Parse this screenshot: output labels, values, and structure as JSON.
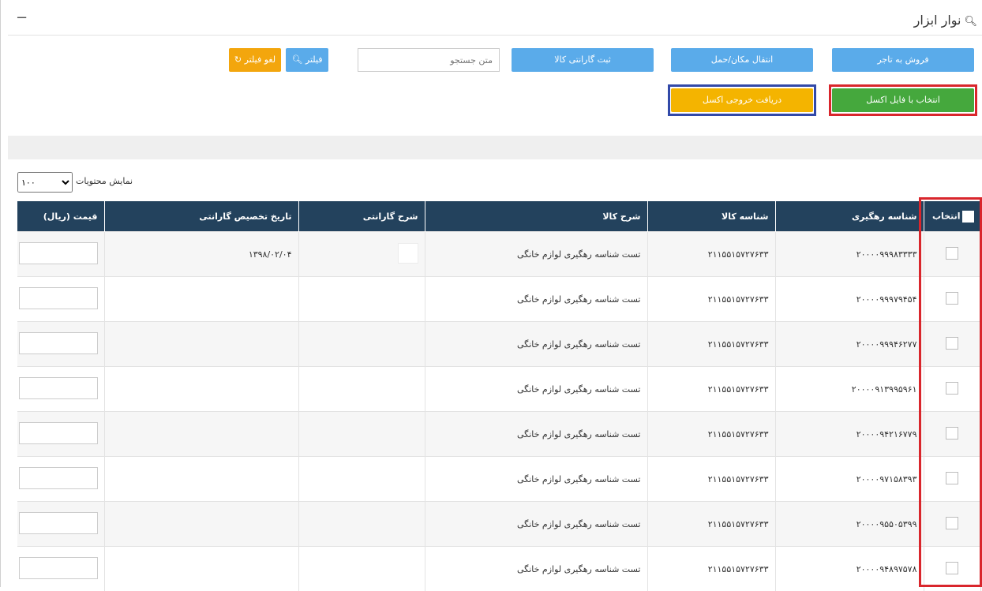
{
  "panel": {
    "title": "نوار ابزار",
    "collapse_symbol": "−"
  },
  "toolbar": {
    "sell_label": "فروش به تاجر",
    "transfer_label": "انتقال مکان/حمل",
    "warranty_label": "ثبت گارانتی کالا",
    "search_placeholder": "متن جستجو",
    "filter_label": "فیلتر",
    "clear_filter_label": "لغو فیلتر",
    "excel_select_label": "انتخاب با فایل اکسل",
    "excel_export_label": "دریافت خروجی اکسل"
  },
  "length": {
    "label": "نمایش محتویات",
    "selected": "۱۰۰"
  },
  "table": {
    "headers": {
      "select": "انتخاب",
      "tracking": "شناسه رهگیری",
      "product_id": "شناسه کالا",
      "product_desc": "شرح کالا",
      "warranty_desc": "شرح گارانتی",
      "warranty_date": "تاریخ تخصیص گارانتی",
      "price": "قیمت (ریال)"
    },
    "rows": [
      {
        "tracking": "۲۰۰۰۰۹۹۹۸۳۳۳۳",
        "product_id": "۲۱۱۵۵۱۵۷۲۷۶۳۳",
        "product_desc": "تست شناسه رهگیری لوازم خانگی",
        "warranty_date": "۱۳۹۸/۰۲/۰۴"
      },
      {
        "tracking": "۲۰۰۰۰۹۹۹۷۹۴۵۴",
        "product_id": "۲۱۱۵۵۱۵۷۲۷۶۳۳",
        "product_desc": "تست شناسه رهگیری لوازم خانگی",
        "warranty_date": ""
      },
      {
        "tracking": "۲۰۰۰۰۹۹۹۴۶۲۷۷",
        "product_id": "۲۱۱۵۵۱۵۷۲۷۶۳۳",
        "product_desc": "تست شناسه رهگیری لوازم خانگی",
        "warranty_date": ""
      },
      {
        "tracking": "۲۰۰۰۰۹۱۳۹۹۵۹۶۱",
        "product_id": "۲۱۱۵۵۱۵۷۲۷۶۳۳",
        "product_desc": "تست شناسه رهگیری لوازم خانگی",
        "warranty_date": ""
      },
      {
        "tracking": "۲۰۰۰۰۹۴۲۱۶۷۷۹",
        "product_id": "۲۱۱۵۵۱۵۷۲۷۶۳۳",
        "product_desc": "تست شناسه رهگیری لوازم خانگی",
        "warranty_date": ""
      },
      {
        "tracking": "۲۰۰۰۰۹۷۱۵۸۳۹۳",
        "product_id": "۲۱۱۵۵۱۵۷۲۷۶۳۳",
        "product_desc": "تست شناسه رهگیری لوازم خانگی",
        "warranty_date": ""
      },
      {
        "tracking": "۲۰۰۰۰۹۵۵۰۵۳۹۹",
        "product_id": "۲۱۱۵۵۱۵۷۲۷۶۳۳",
        "product_desc": "تست شناسه رهگیری لوازم خانگی",
        "warranty_date": ""
      },
      {
        "tracking": "۲۰۰۰۰۹۴۸۹۷۵۷۸",
        "product_id": "۲۱۱۵۵۱۵۷۲۷۶۳۳",
        "product_desc": "تست شناسه رهگیری لوازم خانگی",
        "warranty_date": ""
      }
    ]
  },
  "colors": {
    "header_bg": "#23425d",
    "blue_btn": "#5aabea",
    "green_btn": "#45a83d",
    "orange_btn": "#f3a60d",
    "highlight_red": "#d9262c",
    "highlight_blue": "#3249a8"
  },
  "icons": {
    "search": "search-icon",
    "refresh": "refresh-icon"
  }
}
